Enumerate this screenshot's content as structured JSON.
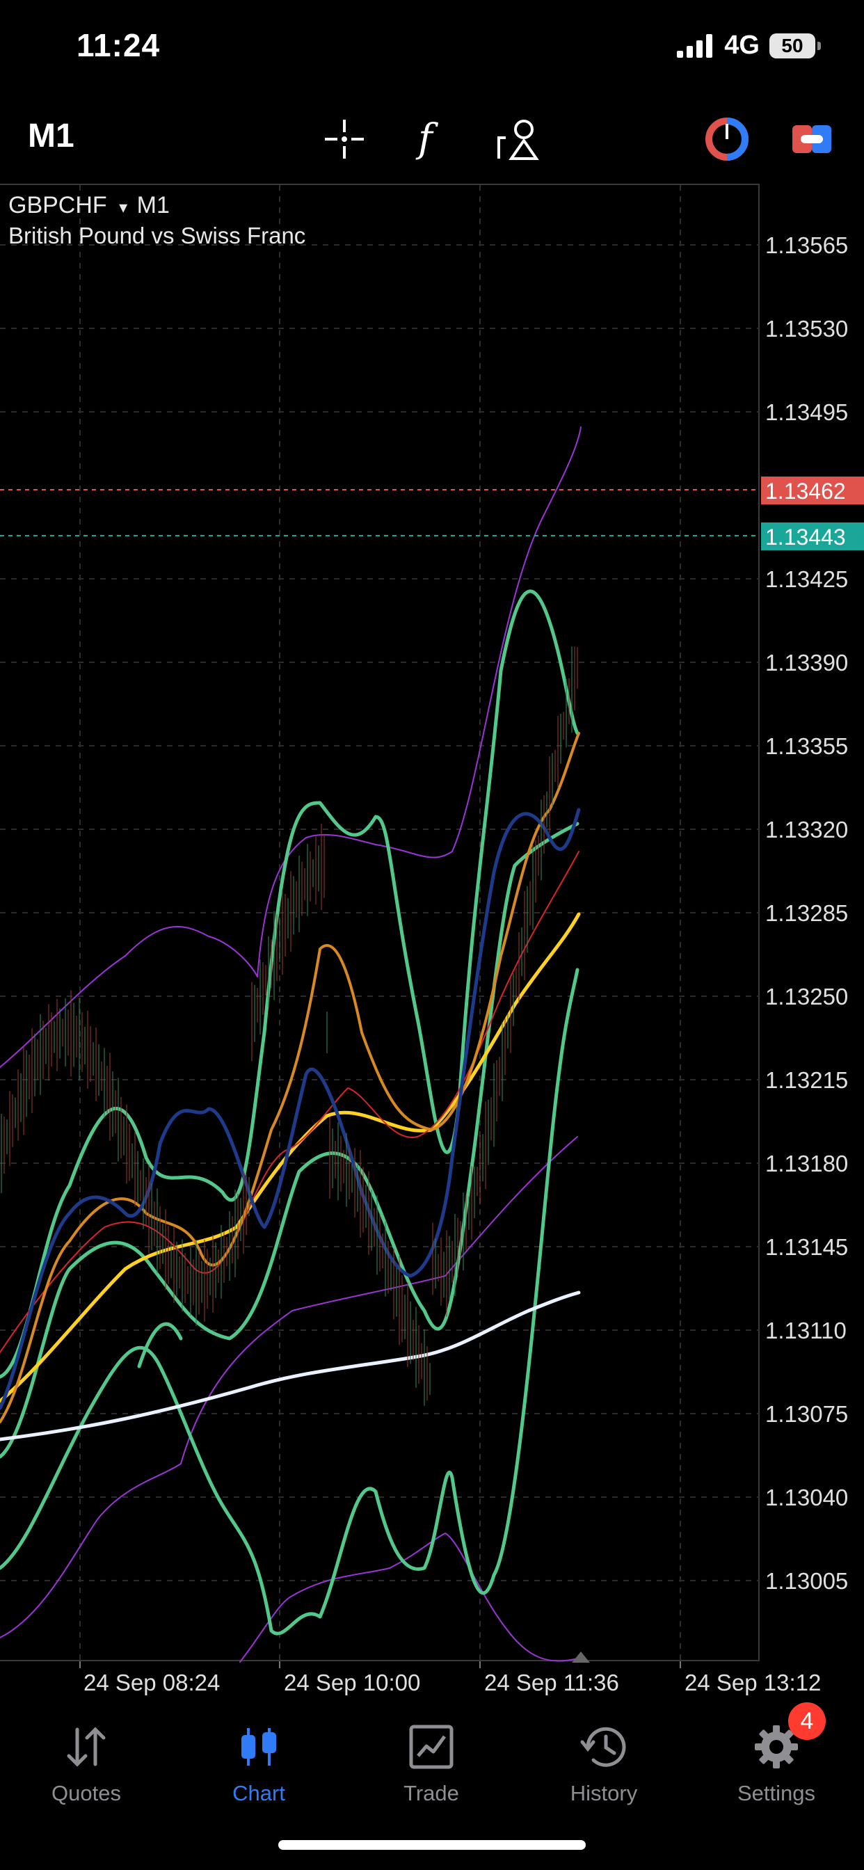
{
  "status_bar": {
    "time": "11:24",
    "network": "4G",
    "battery": "50"
  },
  "toolbar": {
    "timeframe": "M1",
    "icons": [
      "crosshair-icon",
      "function-icon",
      "objects-icon",
      "one-click-trading-icon",
      "account-icon"
    ]
  },
  "chart": {
    "symbol": "GBPCHF",
    "symbol_caret": "▾",
    "period": "M1",
    "description": "British Pound vs Swiss Franc",
    "price_labels": [
      "1.13565",
      "1.13530",
      "1.13495",
      "1.13425",
      "1.13390",
      "1.13355",
      "1.13320",
      "1.13285",
      "1.13250",
      "1.13215",
      "1.13180",
      "1.13145",
      "1.13110",
      "1.13075",
      "1.13040",
      "1.13005"
    ],
    "ask_price": "1.13462",
    "bid_price": "1.13443",
    "time_labels": [
      "24 Sep 08:24",
      "24 Sep 10:00",
      "24 Sep 11:36",
      "24 Sep 13:12"
    ],
    "colors": {
      "ask": "#e0534d",
      "bid": "#1aa79a",
      "grid": "#2c2c2c"
    }
  },
  "tabs": [
    {
      "label": "Quotes",
      "icon": "quotes-icon"
    },
    {
      "label": "Chart",
      "icon": "chart-icon",
      "active": true
    },
    {
      "label": "Trade",
      "icon": "trade-icon"
    },
    {
      "label": "History",
      "icon": "history-icon"
    },
    {
      "label": "Settings",
      "icon": "gear-icon",
      "badge": "4"
    }
  ],
  "accent": "#2f7cf6"
}
